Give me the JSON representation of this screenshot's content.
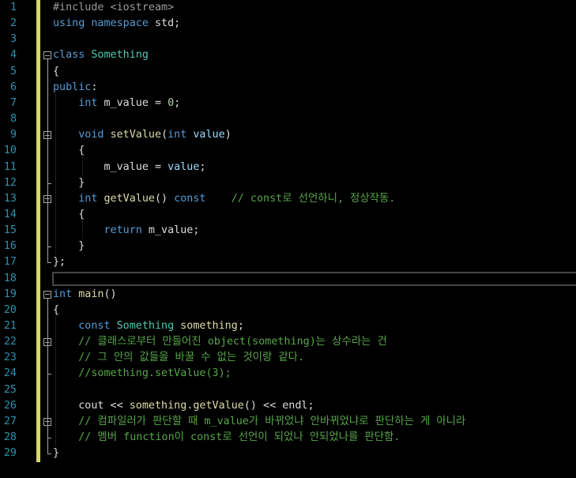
{
  "editor": {
    "lines": [
      {
        "n": "1",
        "tokens": [
          {
            "t": "#include <iostream>",
            "c": "pre"
          }
        ]
      },
      {
        "n": "2",
        "tokens": [
          {
            "t": "using",
            "c": "kw"
          },
          {
            "t": " "
          },
          {
            "t": "namespace",
            "c": "kw"
          },
          {
            "t": " std;"
          }
        ]
      },
      {
        "n": "3",
        "tokens": []
      },
      {
        "n": "4",
        "tokens": [
          {
            "t": "class",
            "c": "kw"
          },
          {
            "t": " "
          },
          {
            "t": "Something",
            "c": "ty"
          }
        ],
        "fold": true
      },
      {
        "n": "5",
        "tokens": [
          {
            "t": "{"
          }
        ]
      },
      {
        "n": "6",
        "tokens": [
          {
            "t": "public",
            "c": "kw"
          },
          {
            "t": ":"
          }
        ]
      },
      {
        "n": "7",
        "tokens": [
          {
            "t": "    "
          },
          {
            "t": "int",
            "c": "kw"
          },
          {
            "t": " m_value = "
          },
          {
            "t": "0",
            "c": "num"
          },
          {
            "t": ";"
          }
        ]
      },
      {
        "n": "8",
        "tokens": []
      },
      {
        "n": "9",
        "tokens": [
          {
            "t": "    "
          },
          {
            "t": "void",
            "c": "kw"
          },
          {
            "t": " "
          },
          {
            "t": "setValue",
            "c": "fn"
          },
          {
            "t": "("
          },
          {
            "t": "int",
            "c": "kw"
          },
          {
            "t": " value",
            "c": "var"
          },
          {
            "t": ")"
          }
        ],
        "fold": true
      },
      {
        "n": "10",
        "tokens": [
          {
            "t": "    {"
          }
        ]
      },
      {
        "n": "11",
        "tokens": [
          {
            "t": "        m_value = "
          },
          {
            "t": "value",
            "c": "var"
          },
          {
            "t": ";"
          }
        ]
      },
      {
        "n": "12",
        "tokens": [
          {
            "t": "    }"
          }
        ]
      },
      {
        "n": "13",
        "tokens": [
          {
            "t": "    "
          },
          {
            "t": "int",
            "c": "kw"
          },
          {
            "t": " "
          },
          {
            "t": "getValue",
            "c": "fn"
          },
          {
            "t": "() "
          },
          {
            "t": "const",
            "c": "kw"
          },
          {
            "t": "    "
          },
          {
            "t": "// const로 선언하니, 정상작동.",
            "c": "cm"
          }
        ],
        "fold": true
      },
      {
        "n": "14",
        "tokens": [
          {
            "t": "    {"
          }
        ]
      },
      {
        "n": "15",
        "tokens": [
          {
            "t": "        "
          },
          {
            "t": "return",
            "c": "kw"
          },
          {
            "t": " m_value;"
          }
        ]
      },
      {
        "n": "16",
        "tokens": [
          {
            "t": "    }"
          }
        ]
      },
      {
        "n": "17",
        "tokens": [
          {
            "t": "};"
          }
        ]
      },
      {
        "n": "18",
        "tokens": [],
        "current": true
      },
      {
        "n": "19",
        "tokens": [
          {
            "t": "int",
            "c": "kw"
          },
          {
            "t": " "
          },
          {
            "t": "main",
            "c": "fn"
          },
          {
            "t": "()"
          }
        ],
        "fold": true
      },
      {
        "n": "20",
        "tokens": [
          {
            "t": "{"
          }
        ]
      },
      {
        "n": "21",
        "tokens": [
          {
            "t": "    "
          },
          {
            "t": "const",
            "c": "kw"
          },
          {
            "t": " "
          },
          {
            "t": "Something",
            "c": "ty"
          },
          {
            "t": " "
          },
          {
            "t": "something",
            "c": "fn"
          },
          {
            "t": ";"
          }
        ]
      },
      {
        "n": "22",
        "tokens": [
          {
            "t": "    "
          },
          {
            "t": "// 클래스로부터 만들어진 object(something)는 상수라는 건",
            "c": "cm"
          }
        ],
        "fold": true
      },
      {
        "n": "23",
        "tokens": [
          {
            "t": "    "
          },
          {
            "t": "// 그 안의 값들을 바꿀 수 없는 것이랑 같다.",
            "c": "cm"
          }
        ]
      },
      {
        "n": "24",
        "tokens": [
          {
            "t": "    "
          },
          {
            "t": "//something.setValue(3);",
            "c": "cm"
          }
        ]
      },
      {
        "n": "25",
        "tokens": []
      },
      {
        "n": "26",
        "tokens": [
          {
            "t": "    cout << "
          },
          {
            "t": "something",
            "c": "fn"
          },
          {
            "t": "."
          },
          {
            "t": "getValue",
            "c": "fn"
          },
          {
            "t": "() << endl;"
          }
        ]
      },
      {
        "n": "27",
        "tokens": [
          {
            "t": "    "
          },
          {
            "t": "// 컴파일러가 판단할 때 m_value가 바뀌었냐 안바뀌었냐로 판단하는 게 아니라",
            "c": "cm"
          }
        ],
        "fold": true
      },
      {
        "n": "28",
        "tokens": [
          {
            "t": "    "
          },
          {
            "t": "// 멤버 function이 const로 선언이 되었나 안되었나를 판단함.",
            "c": "cm"
          }
        ]
      },
      {
        "n": "29",
        "tokens": [
          {
            "t": "}"
          }
        ]
      }
    ]
  },
  "colors": {
    "background": "#000000",
    "line_number": "#2b91af",
    "keyword": "#569cd6",
    "type": "#4ec9b0",
    "function": "#dcdcaa",
    "comment": "#57a64a",
    "change_bar": "#d7d76b"
  }
}
